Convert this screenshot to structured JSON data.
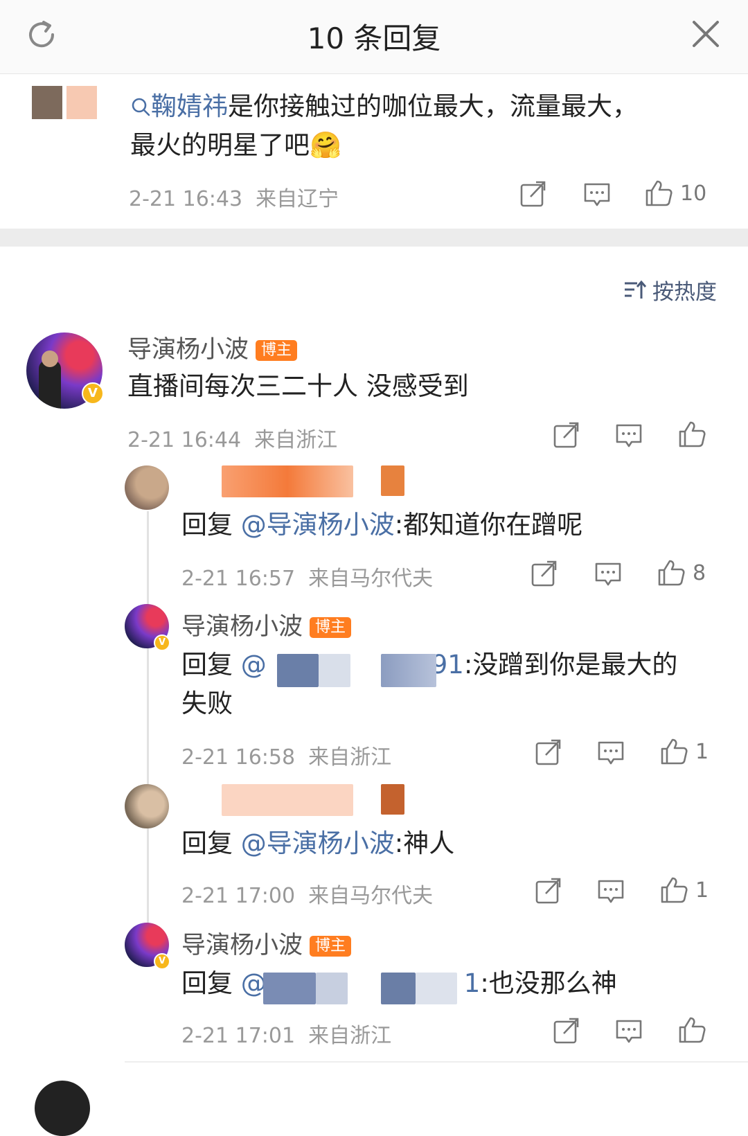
{
  "header": {
    "title": "10 条回复"
  },
  "root_comment": {
    "topic_tag": "鞠婧祎",
    "text_after_tag": "是你接触过的咖位最大，流量最大，",
    "text_line2": "最火的明星了吧",
    "emoji": "🤗",
    "time": "2-21 16:43",
    "location": "来自辽宁",
    "likes": "10"
  },
  "sort": {
    "label": "按热度"
  },
  "main_comment": {
    "author": "导演杨小波",
    "badge": "博主",
    "text": "直播间每次三二十人 没感受到",
    "time": "2-21 16:44",
    "location": "来自浙江",
    "likes": ""
  },
  "replies": [
    {
      "prefix": "回复 ",
      "mention": "@导演杨小波",
      "text": ":都知道你在蹭呢",
      "time": "2-21 16:57",
      "location": "来自马尔代夫",
      "likes": "8"
    },
    {
      "author": "导演杨小波",
      "badge": "博主",
      "prefix": "回复 ",
      "mention_start": "@",
      "mention_end": "91",
      "text": ":没蹭到你是最大的",
      "text_line2": "失败",
      "time": "2-21 16:58",
      "location": "来自浙江",
      "likes": "1"
    },
    {
      "prefix": "回复 ",
      "mention": "@导演杨小波",
      "text": ":神人",
      "time": "2-21 17:00",
      "location": "来自马尔代夫",
      "likes": "1"
    },
    {
      "author": "导演杨小波",
      "badge": "博主",
      "prefix": "回复 ",
      "mention_start": "@",
      "mention_end": "1",
      "text": ":也没那么神",
      "time": "2-21 17:01",
      "location": "来自浙江",
      "likes": ""
    }
  ],
  "icons": {
    "refresh": "refresh-icon",
    "close": "close-icon",
    "share": "share-icon",
    "comment": "comment-icon",
    "like": "thumbs-up-icon",
    "sort": "sort-icon",
    "search": "search-icon"
  },
  "colors": {
    "link": "#4a6fa5",
    "badge": "#ff7d20",
    "meta": "#999999"
  }
}
